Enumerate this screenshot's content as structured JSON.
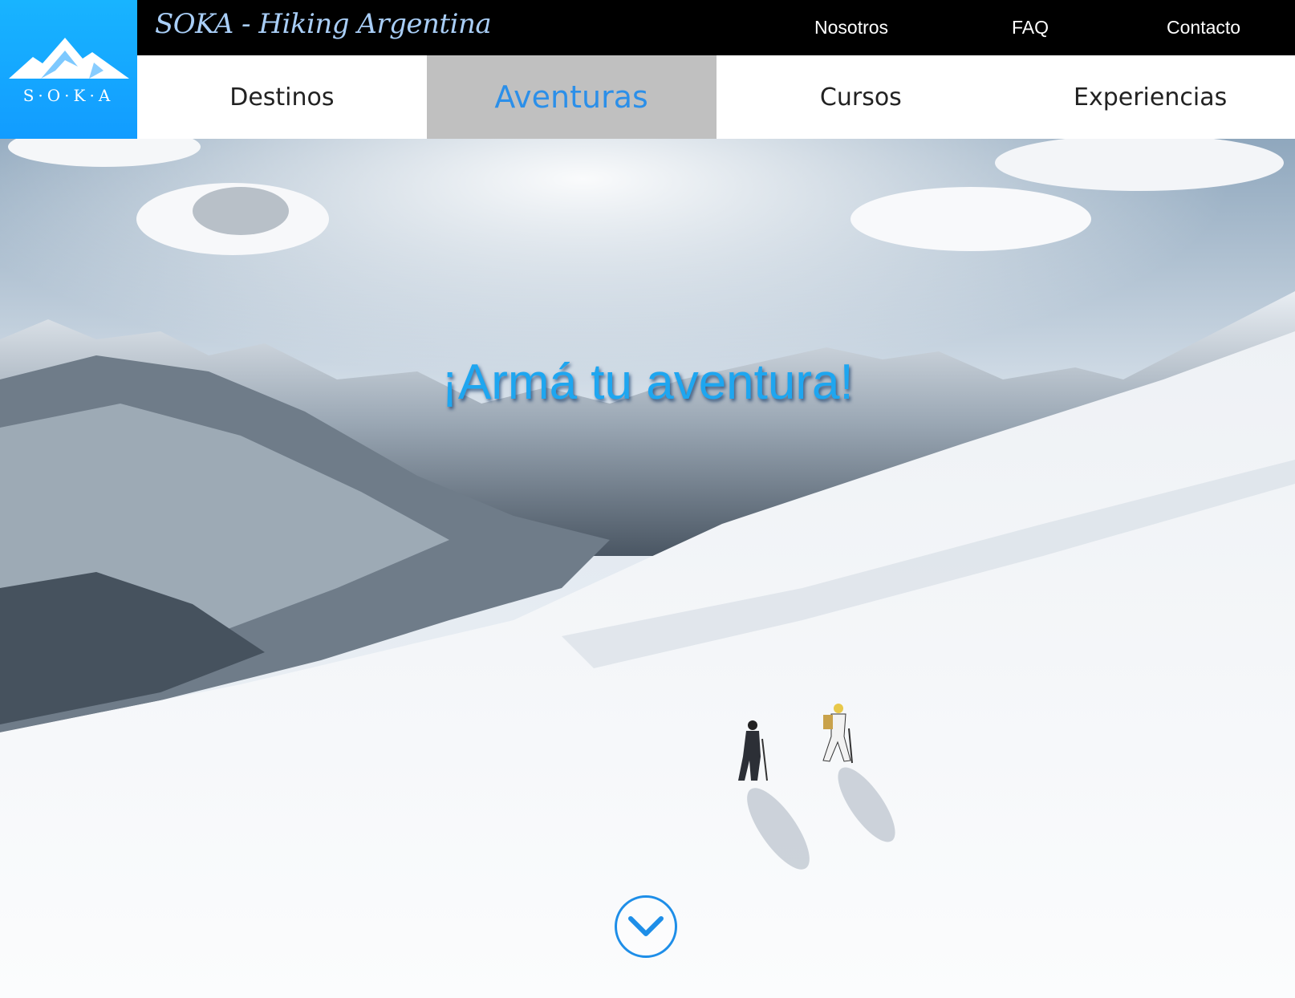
{
  "brand": {
    "logo_text": "S·O·K·A",
    "site_title": "SOKA - Hiking Argentina"
  },
  "top_nav": {
    "links": [
      "Nosotros",
      "FAQ",
      "Contacto"
    ]
  },
  "main_nav": {
    "items": [
      "Destinos",
      "Aventuras",
      "Cursos",
      "Experiencias"
    ],
    "active": "Aventuras"
  },
  "hero": {
    "title": "¡Armá tu aventura!",
    "scroll_icon": "chevron-down-icon",
    "image": "snowy-mountains-two-hikers"
  },
  "colors": {
    "logo_bg": "#129cff",
    "accent": "#2b8fe9",
    "hero_title": "#1ea6f0",
    "active_tab_bg": "#c0c0c0",
    "topbar_bg": "#000000"
  }
}
